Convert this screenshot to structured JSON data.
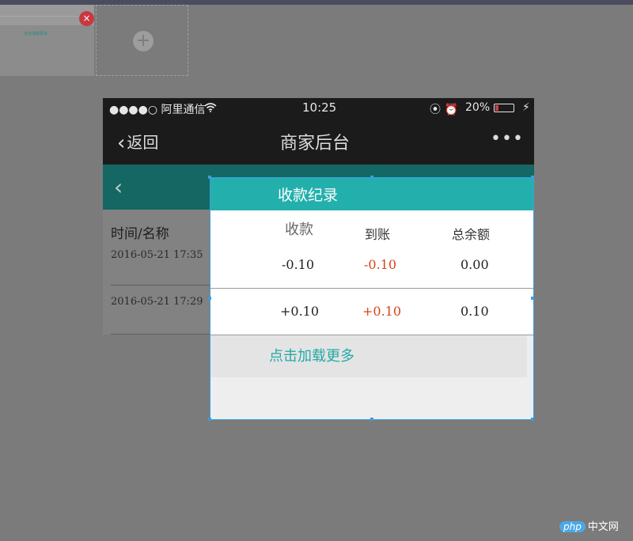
{
  "thumbnail": {
    "link_text": "点击加载更多",
    "close_icon": "close-icon",
    "add_icon": "plus-icon"
  },
  "statusbar": {
    "carrier": "●●●●○ 阿里通信",
    "wifi_icon": "wifi-icon",
    "time": "10:25",
    "right_icons": "⦿ ⏰",
    "battery": "20%",
    "battery_level": 0.2,
    "charging_icon": "bolt-icon"
  },
  "navbar": {
    "back_label": "返回",
    "title": "商家后台",
    "more_label": "•••"
  },
  "tealbar": {
    "back_icon": "chevron-left-icon"
  },
  "list": {
    "header": "时间/名称",
    "rows": [
      {
        "time": "2016-05-21 17:35"
      },
      {
        "time": "2016-05-21 17:29"
      }
    ]
  },
  "popup": {
    "title": "收款纪录",
    "columns": [
      "收款",
      "到账",
      "总余额"
    ],
    "rows": [
      {
        "received": "-0.10",
        "credited": "-0.10",
        "balance": "0.00"
      },
      {
        "received": "+0.10",
        "credited": "+0.10",
        "balance": "0.10"
      }
    ],
    "load_more": "点击加载更多",
    "colors": {
      "header": "#23b0ad",
      "credited": "#d9431a",
      "link": "#25a9a6",
      "selection": "#3a9ee0"
    }
  },
  "watermark": {
    "badge": "php",
    "text": "中文网"
  }
}
